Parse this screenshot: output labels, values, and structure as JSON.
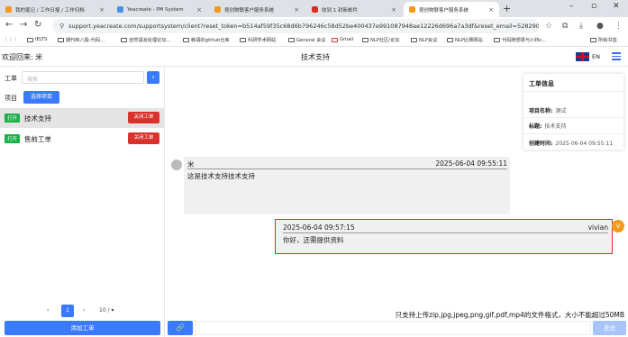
{
  "browser": {
    "tabs": [
      {
        "title": "我的笔记 / 工作日报 / 工作归档"
      },
      {
        "title": "Yeacreate - PM System"
      },
      {
        "title": "昆创物联客户服务系统"
      },
      {
        "title": "收到 1 封新邮件"
      },
      {
        "title": "昆创物联客户服务系统"
      }
    ],
    "new_tab": "+",
    "url": "support.yeacreate.com/supportsystem/client?reset_token=b514af59f35c68d6b796246c58d52be400437e991087948ae12226d696a7a3df&reset_email=528290596@qq.com...",
    "bookmarks": [
      "IELTS",
      "期刊和八股-代码...",
      "自然语言处理论坛...",
      "韩语的github仓库",
      "科研学术网站",
      "General 会议",
      "Gmail",
      "NLP社区/论坛",
      "NLP会议",
      "NLP比赛网站",
      "代码随想录与小林c..."
    ],
    "all_bookmarks": "所有书签"
  },
  "header": {
    "welcome": "欢迎回来: 米",
    "title": "技术支持",
    "lang": "EN"
  },
  "sidebar": {
    "order_label": "工单",
    "search_placeholder": "搜索",
    "search_btn": "‹",
    "project_label": "项目",
    "project_btn": "选择项目",
    "tickets": [
      {
        "status": "打开",
        "name": "技术支持",
        "close": "关闭工单"
      },
      {
        "status": "打开",
        "name": "售前工单",
        "close": "关闭工单"
      }
    ],
    "pager": {
      "prev": "‹",
      "page": "1",
      "next": "›",
      "size": "10 / ▾"
    },
    "add_btn": "添加工单"
  },
  "info": {
    "title": "工单信息",
    "project_key": "项目名称:",
    "project_val": "测试",
    "topic_key": "标题:",
    "topic_val": "技术支持",
    "created_key": "创建时间:",
    "created_val": "2025-06-04 09:55:11"
  },
  "messages": [
    {
      "author": "米",
      "time": "2025-06-04 09:55:11",
      "text": "这是技术支持技术支持"
    },
    {
      "author": "vivian",
      "time": "2025-06-04 09:57:15",
      "text": "你好，还需提供资料",
      "avatar": "V"
    }
  ],
  "composer": {
    "hint": "只支持上传zip,jpg,jpeg,png,gif,pdf,mp4的文件格式，大小不能超过50MB",
    "attach": "🔗",
    "send": "发送"
  }
}
